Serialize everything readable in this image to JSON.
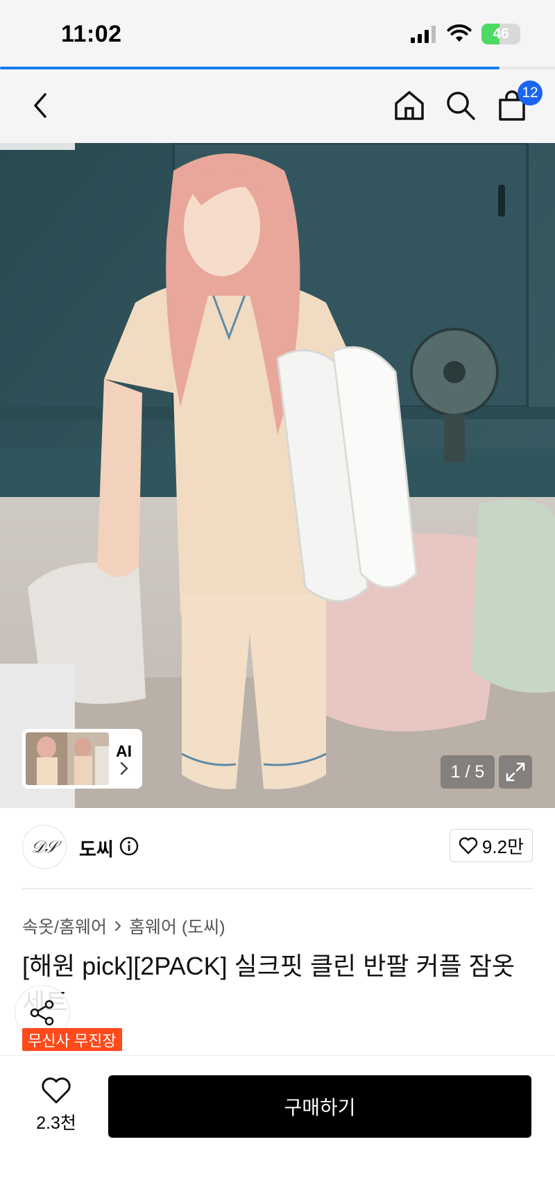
{
  "status_bar": {
    "time": "11:02",
    "battery": "46",
    "battery_level": 0.46,
    "icons": [
      "signal-icon",
      "wifi-icon",
      "battery-icon"
    ]
  },
  "page_load_progress": 0.9,
  "nav": {
    "back_icon": "chevron-left-icon",
    "home_icon": "home-icon",
    "search_icon": "search-icon",
    "cart_icon": "shopping-bag-icon",
    "cart_count": "12"
  },
  "gallery": {
    "ai_label": "AI",
    "counter": "1 / 5",
    "expand_icon": "expand-icon"
  },
  "brand": {
    "name": "도씨",
    "logo_text": "𝒟𝒮",
    "like_count": "9.2만"
  },
  "breadcrumb": {
    "category": "속옷/홈웨어",
    "subcategory": "홈웨어 (도씨)"
  },
  "product": {
    "title": "[해원 pick][2PACK] 실크핏 클린 반팔 커플 잠옷 세트",
    "badge": "무신사 무진장"
  },
  "bottom_bar": {
    "wish_count": "2.3천",
    "buy_label": "구매하기"
  },
  "colors": {
    "accent": "#1a64f0",
    "badge": "#ff4a1c",
    "buy_button": "#000000"
  }
}
